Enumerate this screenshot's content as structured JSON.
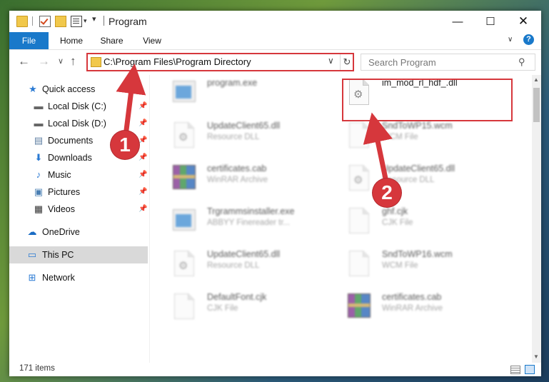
{
  "window": {
    "title": "Program",
    "controls": {
      "minimize": "—",
      "maximize": "☐",
      "close": "✕"
    }
  },
  "ribbon": {
    "tabs": [
      {
        "label": "File"
      },
      {
        "label": "Home"
      },
      {
        "label": "Share"
      },
      {
        "label": "View"
      }
    ],
    "expand_icon": "chevron-down-icon",
    "help_glyph": "?"
  },
  "nav": {
    "address": "C:\\Program Files\\Program Directory",
    "search_placeholder": "Search Program"
  },
  "sidebar": {
    "items": [
      {
        "label": "Quick access",
        "icon": "star-icon"
      },
      {
        "label": "Local Disk (C:)",
        "icon": "drive-icon",
        "pinned": true
      },
      {
        "label": "Local Disk (D:)",
        "icon": "drive-icon",
        "pinned": true
      },
      {
        "label": "Documents",
        "icon": "documents-icon",
        "pinned": true
      },
      {
        "label": "Downloads",
        "icon": "download-icon",
        "pinned": true
      },
      {
        "label": "Music",
        "icon": "music-icon",
        "pinned": true
      },
      {
        "label": "Pictures",
        "icon": "pictures-icon",
        "pinned": true
      },
      {
        "label": "Videos",
        "icon": "videos-icon",
        "pinned": true
      },
      {
        "label": "OneDrive",
        "icon": "cloud-icon"
      },
      {
        "label": "This PC",
        "icon": "computer-icon",
        "selected": true
      },
      {
        "label": "Network",
        "icon": "network-icon"
      }
    ]
  },
  "files": [
    {
      "name": "program.exe",
      "type": "",
      "icon": "exe-icon"
    },
    {
      "name": "im_mod_rl_hdf_.dll",
      "type": "",
      "icon": "dll-icon",
      "highlighted": true
    },
    {
      "name": "UpdateClient65.dll",
      "type": "Resource DLL",
      "icon": "dll-icon"
    },
    {
      "name": "SndToWP15.wcm",
      "type": "WCM File",
      "icon": "file-icon"
    },
    {
      "name": "certificates.cab",
      "type": "WinRAR Archive",
      "icon": "rar-icon"
    },
    {
      "name": "UpdateClient65.dll",
      "type": "Resource DLL",
      "icon": "dll-icon"
    },
    {
      "name": "Trgrammsinstaller.exe",
      "type": "ABBYY Finereader tr...",
      "icon": "exe-icon"
    },
    {
      "name": "ghf.cjk",
      "type": "CJK File",
      "icon": "file-icon"
    },
    {
      "name": "UpdateClient65.dll",
      "type": "Resource DLL",
      "icon": "dll-icon"
    },
    {
      "name": "SndToWP16.wcm",
      "type": "WCM File",
      "icon": "file-icon"
    },
    {
      "name": "DefaultFont.cjk",
      "type": "CJK File",
      "icon": "file-icon"
    },
    {
      "name": "certificates.cab",
      "type": "WinRAR Archive",
      "icon": "rar-icon"
    }
  ],
  "status": {
    "item_count": "171 items"
  },
  "annotations": {
    "step1": "1",
    "step2": "2",
    "color": "#d6373c"
  }
}
